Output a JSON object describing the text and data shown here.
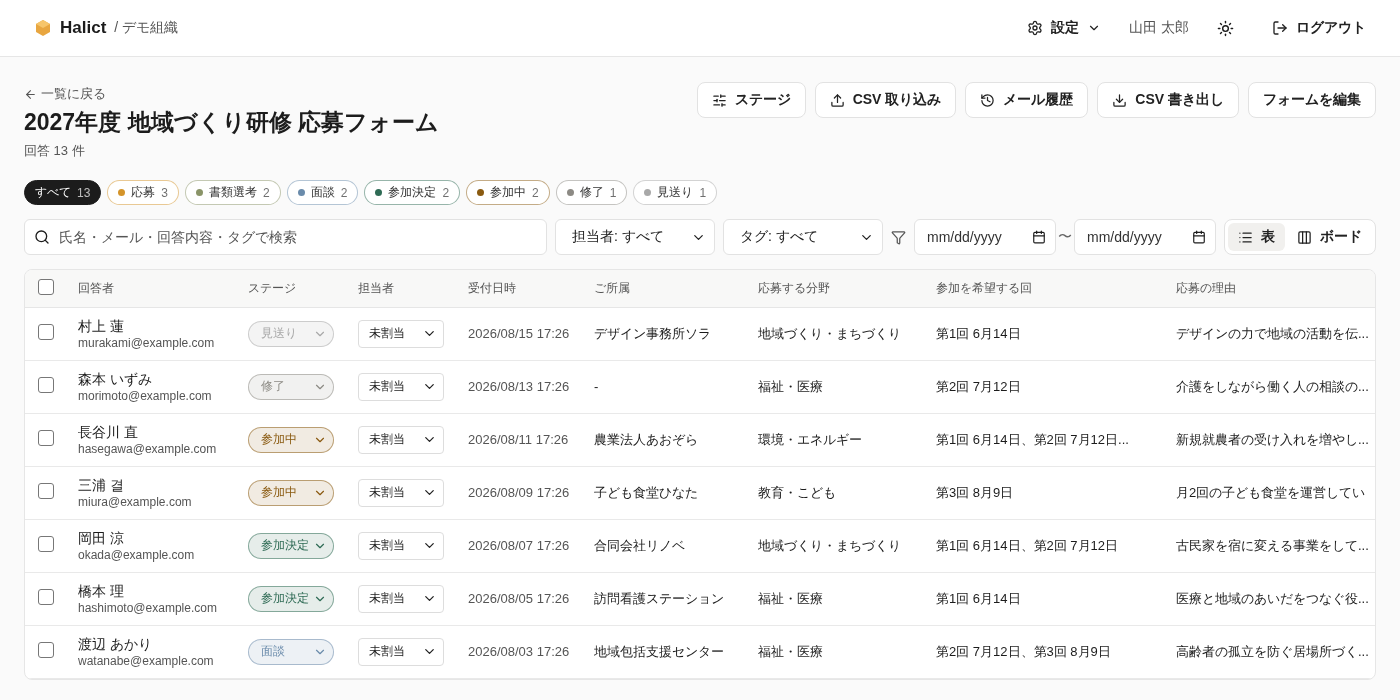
{
  "header": {
    "brand": "Halict",
    "org": "/ デモ組織",
    "settings": "設定",
    "user": "山田 太郎",
    "logout": "ログアウト"
  },
  "back": "一覧に戻る",
  "title": "2027年度 地域づくり研修 応募フォーム",
  "count": "回答 13 件",
  "actions": [
    {
      "label": "ステージ",
      "kind": "stages"
    },
    {
      "label": "CSV 取り込み",
      "kind": "import"
    },
    {
      "label": "メール履歴",
      "kind": "history"
    },
    {
      "label": "CSV 書き出し",
      "kind": "export"
    },
    {
      "label": "フォームを編集",
      "kind": "plain"
    }
  ],
  "chips": [
    {
      "label": "すべて",
      "count": "13",
      "selected": true
    },
    {
      "label": "応募",
      "count": "3",
      "selected": false,
      "color": "#d4942a"
    },
    {
      "label": "書類選考",
      "count": "2",
      "selected": false,
      "color": "#8a9468"
    },
    {
      "label": "面談",
      "count": "2",
      "selected": false,
      "color": "#6a8bab"
    },
    {
      "label": "参加決定",
      "count": "2",
      "selected": false,
      "color": "#2f6b55"
    },
    {
      "label": "参加中",
      "count": "2",
      "selected": false,
      "color": "#8a5a10"
    },
    {
      "label": "修了",
      "count": "1",
      "selected": false,
      "color": "#8c8a84"
    },
    {
      "label": "見送り",
      "count": "1",
      "selected": false,
      "color": "#a8a8a8"
    }
  ],
  "filters": {
    "search_placeholder": "氏名・メール・回答内容・タグで検索",
    "assignee": "担当者: すべて",
    "tag": "タグ: すべて",
    "date_from_placeholder": "mm/dd/yyyy",
    "range_sep": "〜",
    "date_to_placeholder": "mm/dd/yyyy"
  },
  "views": [
    {
      "label": "表",
      "kind": "list",
      "selected": true
    },
    {
      "label": "ボード",
      "kind": "board",
      "selected": false
    }
  ],
  "table": {
    "select_all_checked": false,
    "columns": [
      "回答者",
      "ステージ",
      "担当者",
      "受付日時",
      "ご所属",
      "応募する分野",
      "参加を希望する回",
      "応募の理由"
    ],
    "rows": [
      {
        "checked": false,
        "name": "村上 蓮",
        "email": "murakami@example.com",
        "stage": {
          "label": "見送り",
          "color": "#a8a8a8"
        },
        "assignee": "未割当",
        "date": "2026/08/15 17:26",
        "affiliation": "デザイン事務所ソラ",
        "field": "地域づくり・まちづくり",
        "sessions": "第1回 6月14日",
        "reason": "デザインの力で地域の活動を伝..."
      },
      {
        "checked": false,
        "name": "森本 いずみ",
        "email": "morimoto@example.com",
        "stage": {
          "label": "修了",
          "color": "#8c8a84"
        },
        "assignee": "未割当",
        "date": "2026/08/13 17:26",
        "affiliation": "-",
        "field": "福祉・医療",
        "sessions": "第2回 7月12日",
        "reason": "介護をしながら働く人の相談の..."
      },
      {
        "checked": false,
        "name": "長谷川 直",
        "email": "hasegawa@example.com",
        "stage": {
          "label": "参加中",
          "color": "#8a5a10"
        },
        "assignee": "未割当",
        "date": "2026/08/11 17:26",
        "affiliation": "農業法人あおぞら",
        "field": "環境・エネルギー",
        "sessions": "第1回 6月14日、第2回 7月12日...",
        "reason": "新規就農者の受け入れを増やし..."
      },
      {
        "checked": false,
        "name": "三浦 결",
        "email": "miura@example.com",
        "stage": {
          "label": "参加中",
          "color": "#8a5a10"
        },
        "assignee": "未割当",
        "date": "2026/08/09 17:26",
        "affiliation": "子ども食堂ひなた",
        "field": "教育・こども",
        "sessions": "第3回 8月9日",
        "reason": "月2回の子ども食堂を運営してい"
      },
      {
        "checked": false,
        "name": "岡田 涼",
        "email": "okada@example.com",
        "stage": {
          "label": "参加決定",
          "color": "#2f6b55"
        },
        "assignee": "未割当",
        "date": "2026/08/07 17:26",
        "affiliation": "合同会社リノベ",
        "field": "地域づくり・まちづくり",
        "sessions": "第1回 6月14日、第2回 7月12日",
        "reason": "古民家を宿に変える事業をして..."
      },
      {
        "checked": false,
        "name": "橋本 理",
        "email": "hashimoto@example.com",
        "stage": {
          "label": "参加決定",
          "color": "#2f6b55"
        },
        "assignee": "未割当",
        "date": "2026/08/05 17:26",
        "affiliation": "訪問看護ステーション",
        "field": "福祉・医療",
        "sessions": "第1回 6月14日",
        "reason": "医療と地域のあいだをつなぐ役..."
      },
      {
        "checked": false,
        "name": "渡辺 あかり",
        "email": "watanabe@example.com",
        "stage": {
          "label": "面談",
          "color": "#6a8bab"
        },
        "assignee": "未割当",
        "date": "2026/08/03 17:26",
        "affiliation": "地域包括支援センター",
        "field": "福祉・医療",
        "sessions": "第2回 7月12日、第3回 8月9日",
        "reason": "高齢者の孤立を防ぐ居場所づく..."
      }
    ]
  }
}
